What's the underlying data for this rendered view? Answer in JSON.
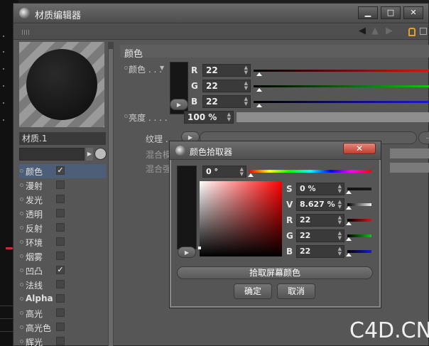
{
  "window": {
    "title": "材质编辑器",
    "controls": [
      "▁",
      "□",
      "✕"
    ]
  },
  "material": {
    "name": "材质.1"
  },
  "channels": [
    {
      "label": "颜色",
      "checked": true,
      "active": true
    },
    {
      "label": "漫射",
      "checked": false
    },
    {
      "label": "发光",
      "checked": false
    },
    {
      "label": "透明",
      "checked": false
    },
    {
      "label": "反射",
      "checked": false
    },
    {
      "label": "环境",
      "checked": false
    },
    {
      "label": "烟雾",
      "checked": false
    },
    {
      "label": "凹凸",
      "checked": true
    },
    {
      "label": "法线",
      "checked": false
    },
    {
      "label": "Alpha",
      "checked": false,
      "bold": true
    },
    {
      "label": "高光",
      "checked": false
    },
    {
      "label": "高光色",
      "checked": false
    },
    {
      "label": "辉光",
      "checked": false
    }
  ],
  "color_section": {
    "title": "颜色",
    "color_label": "颜色 . . .",
    "r_label": "R",
    "r_value": "22",
    "g_label": "G",
    "g_value": "22",
    "b_label": "B",
    "b_value": "22",
    "brightness_label": "亮度 . . . .",
    "brightness_value": "100 %",
    "texture_label": "纹理 . . . .",
    "texture_more": "...",
    "mix_mode_label": "混合模式",
    "mix_strength_label": "混合强度",
    "slider_colors": {
      "r": "#d01818",
      "g": "#18c018",
      "b": "#1818d8"
    }
  },
  "picker": {
    "title": "颜色拾取器",
    "hue_value": "0 °",
    "s_label": "S",
    "s_value": "0 %",
    "v_label": "V",
    "v_value": "8.627 %",
    "r_label": "R",
    "r_value": "22",
    "g_label": "G",
    "g_value": "22",
    "b_label": "B",
    "b_value": "22",
    "pick_screen_label": "拾取屏幕颜色",
    "ok_label": "确定",
    "cancel_label": "取消",
    "current_color": "#161616"
  },
  "watermark": "C4D.CN"
}
